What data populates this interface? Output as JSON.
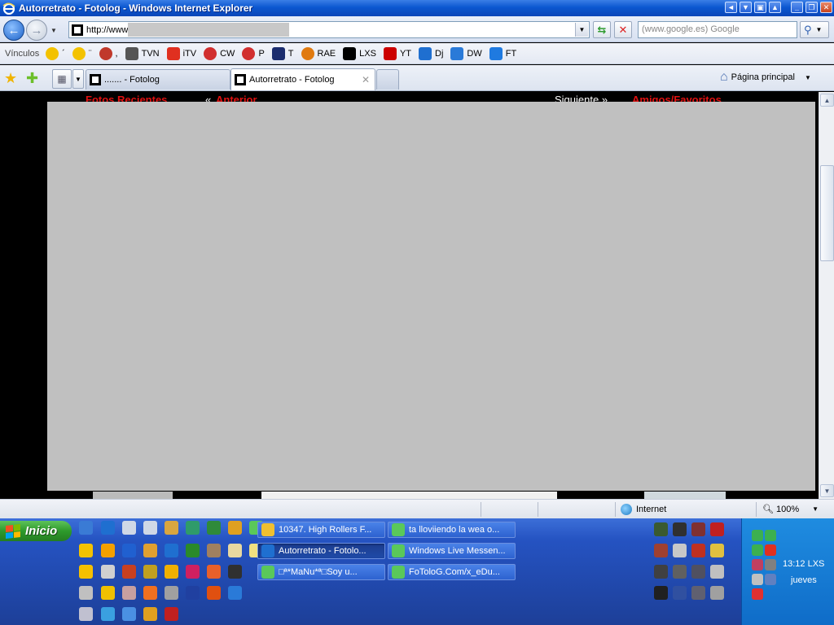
{
  "window": {
    "title": "Autorretrato - Fotolog - Windows Internet Explorer",
    "controls": [
      "minimize",
      "restore",
      "close"
    ]
  },
  "address_bar": {
    "url": "http://www",
    "search_placeholder": "(www.google.es) Google"
  },
  "links_bar": {
    "label": "Vínculos",
    "links": [
      {
        "label": "´",
        "icon": "smiley-icon",
        "color": "#f3c200"
      },
      {
        "label": "¨",
        "icon": "smiley-icon",
        "color": "#f3c200"
      },
      {
        "label": ",",
        "icon": "globe-icon",
        "color": "#c0392b"
      },
      {
        "label": "TVN",
        "icon": "diamond-icon",
        "color": "#555555"
      },
      {
        "label": "iTV",
        "icon": "tv-icon",
        "color": "#e03020"
      },
      {
        "label": "CW",
        "icon": "flag-icon",
        "color": "#d12f2f"
      },
      {
        "label": "P",
        "icon": "flag-icon",
        "color": "#d12f2f"
      },
      {
        "label": "T",
        "icon": "stripe-icon",
        "color": "#1a2c6e"
      },
      {
        "label": "RAE",
        "icon": "seal-icon",
        "color": "#e07a10"
      },
      {
        "label": "LXS",
        "icon": "square-icon",
        "color": "#000000"
      },
      {
        "label": "YT",
        "icon": "youtube-icon",
        "color": "#cc0000"
      },
      {
        "label": "Dj",
        "icon": "ie-icon",
        "color": "#1f6fd0"
      },
      {
        "label": "DW",
        "icon": "dw-icon",
        "color": "#2a7ad8"
      },
      {
        "label": "FT",
        "icon": "ft-icon",
        "color": "#1f7ae0"
      }
    ]
  },
  "tabs": [
    {
      "label": "....... - Fotolog",
      "active": false
    },
    {
      "label": "Autorretrato - Fotolog",
      "active": true
    }
  ],
  "home_label": "Página principal",
  "page": {
    "nav_left_1": "Fotos Recientes",
    "nav_left_2_prefix": "«",
    "nav_left_2": "Anterior",
    "nav_right_1": "Siguiente »",
    "nav_right_2": "Amigos/Favoritos"
  },
  "status_bar": {
    "zone": "Internet",
    "zoom": "100%"
  },
  "taskbar": {
    "start_label": "Inicio",
    "tasks": [
      {
        "label": "10347. High Rollers F...",
        "active": false,
        "icon_color": "#f0c030"
      },
      {
        "label": "ta lloviiendo la wea o...",
        "active": false,
        "icon_color": "#5ac85a"
      },
      {
        "label": "Autorretrato - Fotolo...",
        "active": true,
        "icon_color": "#1f6fd0"
      },
      {
        "label": "Windows Live Messen...",
        "active": false,
        "icon_color": "#5ac85a"
      },
      {
        "label": "□ª*MaNu*ª□Soy u...",
        "active": false,
        "icon_color": "#5ac85a"
      },
      {
        "label": "FoToloG.Com/x_eDu...",
        "active": false,
        "icon_color": "#5ac85a"
      }
    ],
    "clock": "13:12 LXS",
    "day": "jueves"
  }
}
